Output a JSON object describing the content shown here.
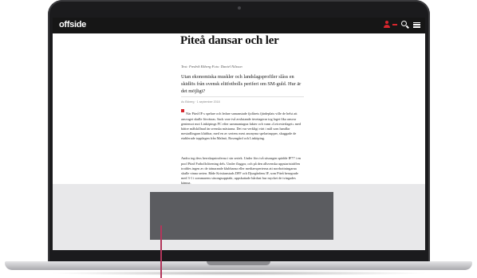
{
  "site": {
    "logo": "offside",
    "brand_color": "#d7262d"
  },
  "nav": {
    "icons": [
      "user-icon",
      "search-icon",
      "menu-icon"
    ]
  },
  "article": {
    "headline": "Piteå dansar och ler",
    "byline": "Text: Fredrik Ekberg   Foto: Daniel Nilsson",
    "lede": "Utan ekonomiska muskler och landslagsprofiler slåss en skidlös från svensk elitfotbolls periferi om SM-guld. Hur är det möjligt?",
    "meta": "Av Ekberg · 1 september 2018",
    "paragraphs": [
      "När Piteå IF:s spelare och ledare samanstade fjolårets fjärdeplats ville de helst att ansvaget skulle förvärras. Sack vare två avslutande ärvetagerar tog laget fika ansvar gentemot mot Linköpings FC efter sammantagna fakter och vann «Leicesterlaget» med bättre målskillnad än svenska mästarna. Det var verkligt värt i mål som handlar mestadlingarn klubbar, med en av seriens mest anonyma spelartrupper, skuggade de etablerade topplagen från Malmö, Rosengård och Linköping.",
      "Andra tog dess herrskapstroferna i sin seriek. Under förs två säsongen spädde IF77 i en pool Piteå Fotbollsförening dels. Under flaggor, och på den allsvenska uppstartsträffen troddes ingen av de tränarande klubbarna eller mediaexperterna att norrbottningarna skulle vinna serien. Både Kristianstads DFF och Djurgårdens IF, som Piteå besegrade med 3-1 i sommarens säsongsupptakt, uppskattade hårdast hur mycket de tvingades kämpa."
    ]
  },
  "ad": {
    "color": "#5b5c60"
  }
}
